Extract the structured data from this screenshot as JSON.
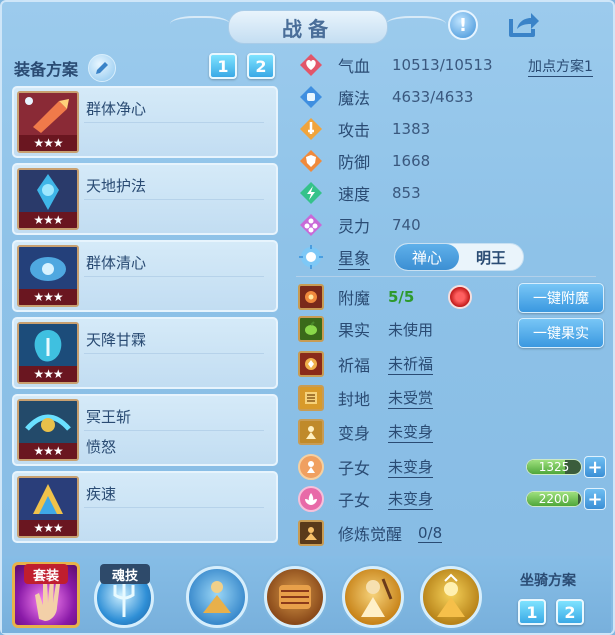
{
  "header": {
    "title": "战备"
  },
  "equipment": {
    "title": "装备方案",
    "plan_buttons": [
      "1",
      "2"
    ],
    "items": [
      {
        "name": "群体净心",
        "sub": "",
        "stars": "★★★"
      },
      {
        "name": "天地护法",
        "sub": "",
        "stars": "★★★"
      },
      {
        "name": "群体清心",
        "sub": "",
        "stars": "★★★"
      },
      {
        "name": "天降甘霖",
        "sub": "",
        "stars": "★★★"
      },
      {
        "name": "冥王斩",
        "sub": "愤怒",
        "stars": "★★★"
      },
      {
        "name": "疾速",
        "sub": "",
        "stars": "★★★"
      }
    ]
  },
  "stats": {
    "plan_link": "加点方案1",
    "rows": [
      {
        "label": "气血",
        "value": "10513/10513",
        "icon": "heart-icon",
        "color": "#e2566a"
      },
      {
        "label": "魔法",
        "value": "4633/4633",
        "icon": "mana-icon",
        "color": "#3f8fe0"
      },
      {
        "label": "攻击",
        "value": "1383",
        "icon": "sword-icon",
        "color": "#f0a43c"
      },
      {
        "label": "防御",
        "value": "1668",
        "icon": "shield-icon",
        "color": "#f08a3c"
      },
      {
        "label": "速度",
        "value": "853",
        "icon": "speed-icon",
        "color": "#35c28a"
      },
      {
        "label": "灵力",
        "value": "740",
        "icon": "spirit-icon",
        "color": "#c86ad8"
      }
    ],
    "star_label": "星象",
    "star_options": [
      "禅心",
      "明王"
    ]
  },
  "actions": {
    "rows": [
      {
        "label": "附魔",
        "value": "5/5"
      },
      {
        "label": "果实",
        "value": "未使用"
      },
      {
        "label": "祈福",
        "value": "未祈福"
      },
      {
        "label": "封地",
        "value": "未受赏"
      },
      {
        "label": "变身",
        "value": "未变身"
      },
      {
        "label": "子女",
        "value": "未变身"
      },
      {
        "label": "子女",
        "value": "未变身"
      },
      {
        "label": "修炼觉醒",
        "value": "0/8"
      }
    ],
    "one_click_enchant": "一键附魔",
    "one_click_fruit": "一键果实",
    "bar1": {
      "value": "1325",
      "fill": 0.7
    },
    "bar2": {
      "value": "2200",
      "fill": 0.95
    }
  },
  "bottom": {
    "suit_label": "套装",
    "soul_label": "魂技",
    "mount_plan_title": "坐骑方案",
    "mount_plan_buttons": [
      "1",
      "2"
    ]
  }
}
